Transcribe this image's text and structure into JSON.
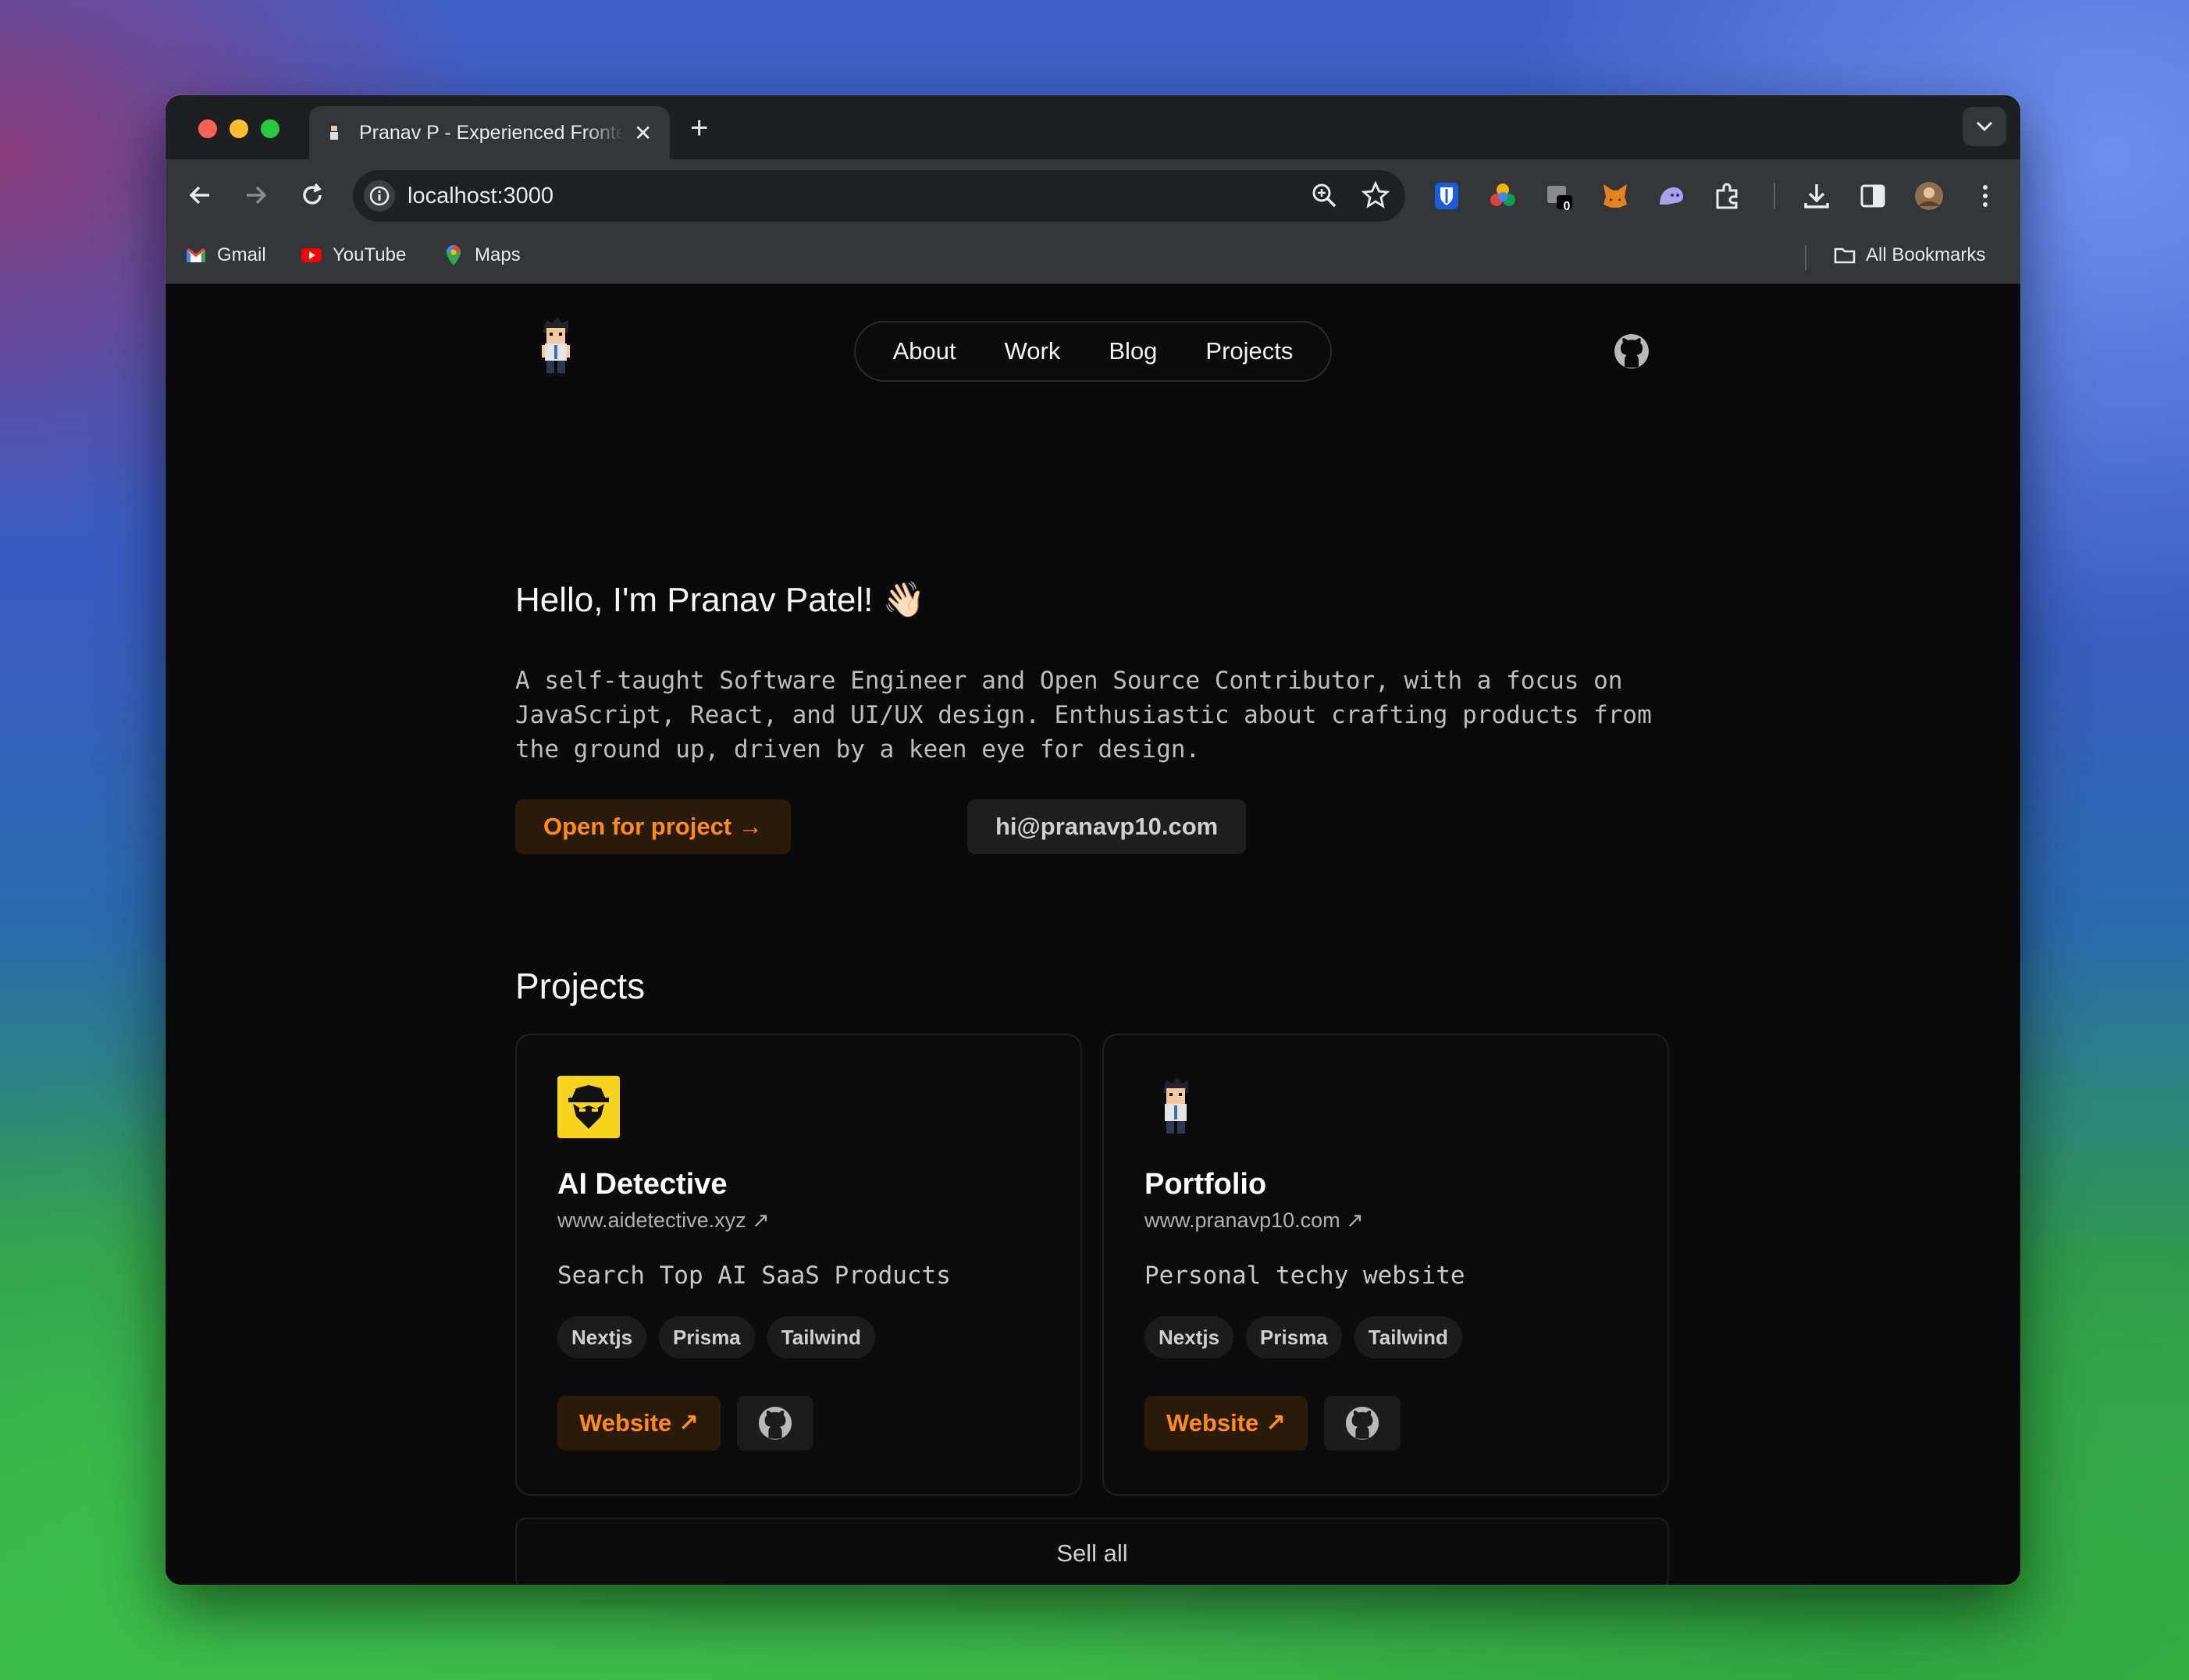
{
  "browser": {
    "tab_title": "Pranav P - Experienced Frontend",
    "tab_close": "✕",
    "new_tab": "+",
    "url": "localhost:3000",
    "extension_badge": "0",
    "bookmarks": [
      {
        "label": "Gmail",
        "icon": "gmail-icon"
      },
      {
        "label": "YouTube",
        "icon": "youtube-icon"
      },
      {
        "label": "Maps",
        "icon": "maps-icon"
      }
    ],
    "all_bookmarks": "All Bookmarks"
  },
  "site": {
    "nav": [
      "About",
      "Work",
      "Blog",
      "Projects"
    ],
    "hello": "Hello, I'm Pranav Patel! 👋🏻",
    "bio": "A self-taught Software Engineer and Open Source Contributor, with a focus on JavaScript, React, and UI/UX design. Enthusiastic about crafting products from the ground up, driven by a keen eye for design.",
    "open_btn": "Open for project →",
    "email_btn": "hi@pranavp10.com",
    "projects_heading": "Projects",
    "projects": [
      {
        "title": "AI Detective",
        "url": "www.aidetective.xyz ↗",
        "description": "Search Top AI SaaS Products",
        "tags": [
          "Nextjs",
          "Prisma",
          "Tailwind"
        ],
        "website_label": "Website ↗"
      },
      {
        "title": "Portfolio",
        "url": "www.pranavp10.com ↗",
        "description": "Personal techy website",
        "tags": [
          "Nextjs",
          "Prisma",
          "Tailwind"
        ],
        "website_label": "Website ↗"
      }
    ],
    "sell_all": "Sell all"
  },
  "colors": {
    "accent_orange": "#ff8c1a",
    "page_bg": "#0a0a0a",
    "chrome_toolbar": "#35363a"
  }
}
